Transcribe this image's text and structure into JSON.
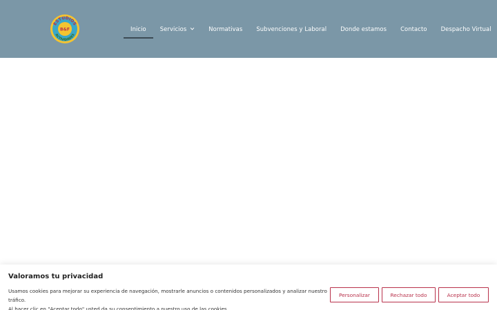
{
  "header": {
    "logo": {
      "top_text": "ESTUDIOS",
      "bottom_text": "ACTIVIDADES",
      "center_text": "B&F"
    },
    "nav": [
      {
        "label": "Inicio",
        "active": true,
        "dropdown": false
      },
      {
        "label": "Servicios",
        "active": false,
        "dropdown": true
      },
      {
        "label": "Normativas",
        "active": false,
        "dropdown": false
      },
      {
        "label": "Subvenciones y Laboral",
        "active": false,
        "dropdown": false
      },
      {
        "label": "Donde estamos",
        "active": false,
        "dropdown": false
      },
      {
        "label": "Contacto",
        "active": false,
        "dropdown": false
      },
      {
        "label": "Despacho Virtual",
        "active": false,
        "dropdown": false
      }
    ]
  },
  "cookie_banner": {
    "title": "Valoramos tu privacidad",
    "text_line1": "Usamos cookies para mejorar su experiencia de navegación, mostrarle anuncios o contenidos personalizados y analizar nuestro tráfico.",
    "text_line2": "Al hacer clic en \"Aceptar todo\" usted da su consentimiento a nuestro uso de las cookies.",
    "buttons": {
      "customize": "Personalizar",
      "reject": "Rechazar todo",
      "accept": "Aceptar todo"
    }
  },
  "colors": {
    "header_bg": "#7b97a7",
    "accent": "#b8304a",
    "active_underline": "#3c4a54"
  }
}
